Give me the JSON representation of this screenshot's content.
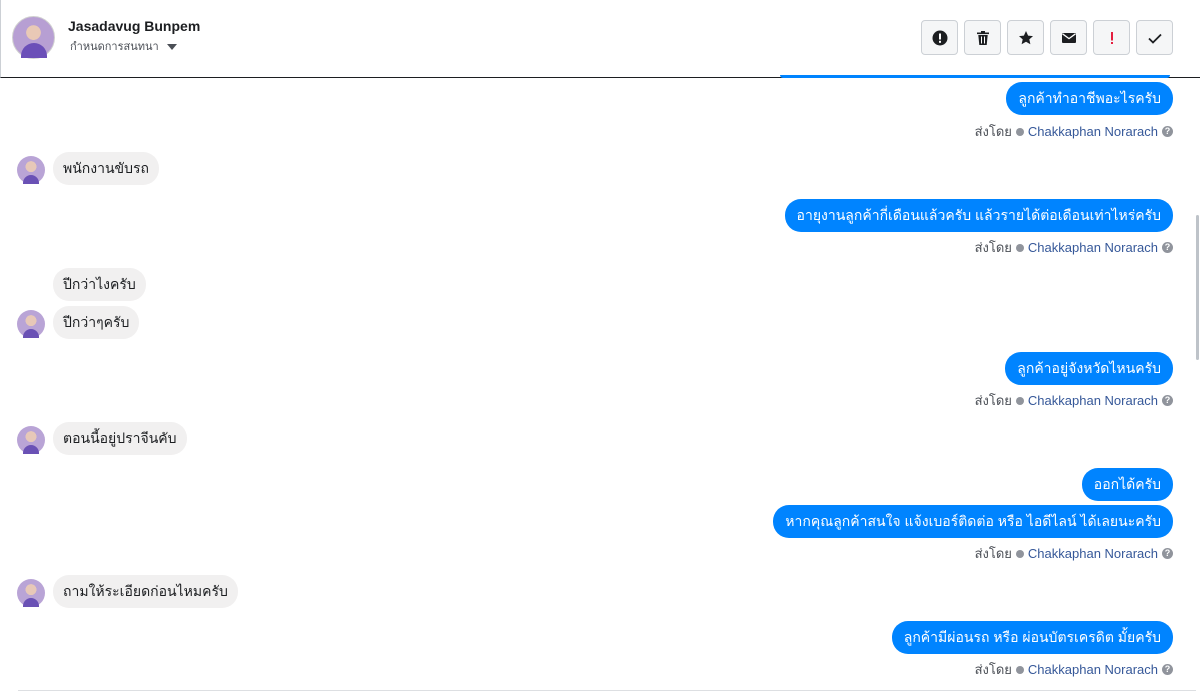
{
  "header": {
    "name": "Jasadavug Bunpem",
    "subtitle": "กำหนดการสนทนา"
  },
  "toolbar": {
    "buttons": [
      {
        "name": "report-spam",
        "icon": "exclamation-circle-icon"
      },
      {
        "name": "delete",
        "icon": "trash-icon"
      },
      {
        "name": "star",
        "icon": "star-icon"
      },
      {
        "name": "mark-unread",
        "icon": "envelope-icon"
      },
      {
        "name": "follow-up",
        "icon": "red-exclamation-icon"
      },
      {
        "name": "mark-done",
        "icon": "check-icon"
      }
    ]
  },
  "colors": {
    "outgoing_bubble": "#0084ff",
    "incoming_bubble": "#f1f0f0",
    "agent_name": "#365899",
    "follow_up_red": "#e41e3f"
  },
  "sent_by_prefix": "ส่งโดย",
  "agent_name": "Chakkaphan Norarach",
  "messages": [
    {
      "dir": "out",
      "text": "ลูกค้าทำอาชีพอะไรครับ"
    },
    {
      "dir": "in",
      "text": "พนักงานขับรถ"
    },
    {
      "dir": "out",
      "text": "อายุงานลูกค้ากี่เดือนแล้วครับ แล้วรายได้ต่อเดือนเท่าไหร่ครับ"
    },
    {
      "dir": "in",
      "text": "ปีกว่าไงครับ"
    },
    {
      "dir": "in",
      "text": "ปีกว่าๆครับ"
    },
    {
      "dir": "out",
      "text": "ลูกค้าอยู่จังหวัดไหนครับ"
    },
    {
      "dir": "in",
      "text": "ตอนนี้อยู่ปราจีนคับ"
    },
    {
      "dir": "out",
      "text": "ออกได้ครับ"
    },
    {
      "dir": "out",
      "text": "หากคุณลูกค้าสนใจ แจ้งเบอร์ติดต่อ หรือ ไอดีไลน์ ได้เลยนะครับ"
    },
    {
      "dir": "in",
      "text": "ถามให้ระเอียดก่อนไหมครับ"
    },
    {
      "dir": "out",
      "text": "ลูกค้ามีผ่อนรถ หรือ ผ่อนบัตรเครดิต มั้ยครับ"
    }
  ]
}
